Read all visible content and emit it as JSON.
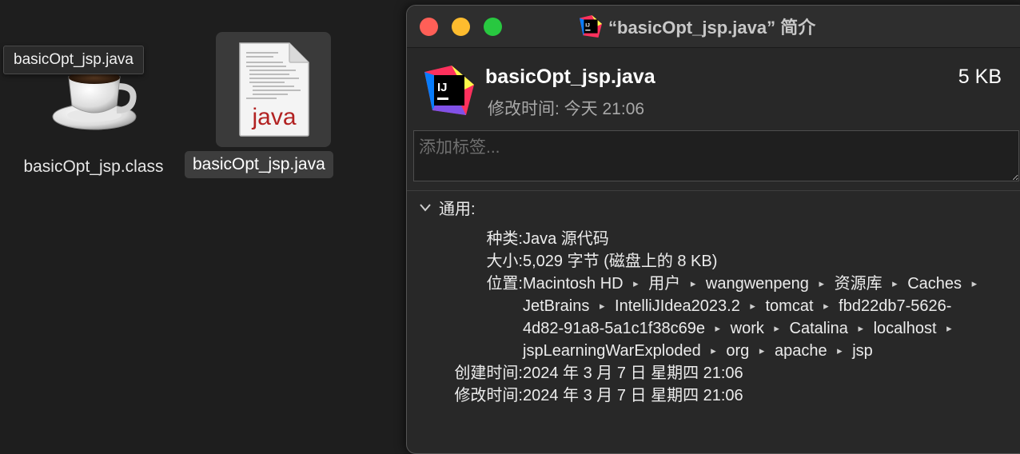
{
  "desktop": {
    "tooltip": "basicOpt_jsp.java",
    "class_file_label": "basicOpt_jsp.class",
    "java_file_label": "basicOpt_jsp.java",
    "java_icon_text": "java"
  },
  "window": {
    "title": "“basicOpt_jsp.java” 简介",
    "file_name": "basicOpt_jsp.java",
    "file_size": "5 KB",
    "modified_short": "修改时间: 今天 21:06",
    "app_icon_text": "IJ",
    "tag_placeholder": "添加标签...",
    "section": "通用:",
    "info": {
      "kind_label": "种类:",
      "kind_value": "Java 源代码",
      "size_label": "大小:",
      "size_value": "5,029 字节 (磁盘上的 8 KB)",
      "location_label": "位置:",
      "path": [
        "Macintosh HD",
        "用户",
        "wangwenpeng",
        "资源库",
        "Caches",
        "JetBrains",
        "IntelliJIdea2023.2",
        "tomcat",
        "fbd22db7-5626-4d82-91a8-5a1c1f38c69e",
        "work",
        "Catalina",
        "localhost",
        "jspLearningWarExploded",
        "org",
        "apache",
        "jsp"
      ],
      "created_label": "创建时间:",
      "created_value": "2024 年 3 月 7 日 星期四 21:06",
      "modified_label": "修改时间:",
      "modified_value": "2024 年 3 月 7 日 星期四 21:06"
    }
  },
  "colors": {
    "close": "#ff5f57",
    "minimize": "#febc2e",
    "maximize": "#28c840",
    "java_red": "#b22222"
  },
  "icons": [
    "coffee-cup-icon",
    "java-document-icon",
    "intellij-idea-icon",
    "chevron-down-icon"
  ]
}
